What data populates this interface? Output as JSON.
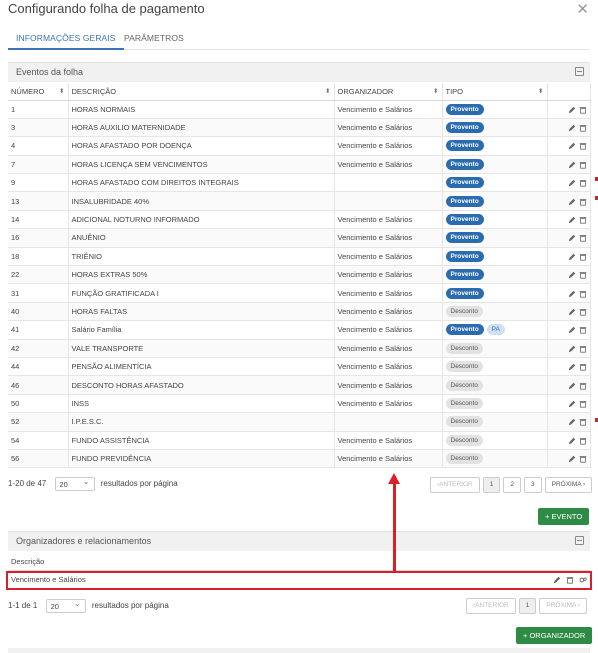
{
  "dialog": {
    "title": "Configurando folha de pagamento"
  },
  "tabs": [
    {
      "label": "INFORMAÇÕES GERAIS",
      "active": true
    },
    {
      "label": "PARÂMETROS",
      "active": false
    }
  ],
  "events_panel": {
    "title": "Eventos da folha",
    "columns": [
      "NÚMERO",
      "DESCRIÇÃO",
      "ORGANIZADOR",
      "TIPO"
    ],
    "rows": [
      {
        "num": "1",
        "desc": "HORAS NORMAIS",
        "org": "Vencimento e Salários",
        "tipo": "Provento"
      },
      {
        "num": "3",
        "desc": "HORAS AUXILIO MATERNIDADE",
        "org": "Vencimento e Salários",
        "tipo": "Provento"
      },
      {
        "num": "4",
        "desc": "HORAS AFASTADO POR DOENÇA",
        "org": "Vencimento e Salários",
        "tipo": "Provento"
      },
      {
        "num": "7",
        "desc": "HORAS LICENÇA SEM VENCIMENTOS",
        "org": "Vencimento e Salários",
        "tipo": "Provento"
      },
      {
        "num": "9",
        "desc": "HORAS AFASTADO COM DIREITOS INTEGRAIS",
        "org": "",
        "tipo": "Provento"
      },
      {
        "num": "13",
        "desc": "INSALUBRIDADE 40%",
        "org": "",
        "tipo": "Provento"
      },
      {
        "num": "14",
        "desc": "ADICIONAL NOTURNO INFORMADO",
        "org": "Vencimento e Salários",
        "tipo": "Provento"
      },
      {
        "num": "16",
        "desc": "ANUÊNIO",
        "org": "Vencimento e Salários",
        "tipo": "Provento"
      },
      {
        "num": "18",
        "desc": "TRIÊNIO",
        "org": "Vencimento e Salários",
        "tipo": "Provento"
      },
      {
        "num": "22",
        "desc": "HORAS EXTRAS 50%",
        "org": "Vencimento e Salários",
        "tipo": "Provento"
      },
      {
        "num": "31",
        "desc": "FUNÇÃO GRATIFICADA I",
        "org": "Vencimento e Salários",
        "tipo": "Provento"
      },
      {
        "num": "40",
        "desc": "HORAS FALTAS",
        "org": "Vencimento e Salários",
        "tipo": "Desconto"
      },
      {
        "num": "41",
        "desc": "Salário Família",
        "org": "Vencimento e Salários",
        "tipo": "Provento",
        "extra": "PA"
      },
      {
        "num": "42",
        "desc": "VALE TRANSPORTE",
        "org": "Vencimento e Salários",
        "tipo": "Desconto"
      },
      {
        "num": "44",
        "desc": "PENSÃO ALIMENTÍCIA",
        "org": "Vencimento e Salários",
        "tipo": "Desconto"
      },
      {
        "num": "46",
        "desc": "DESCONTO HORAS AFASTADO",
        "org": "Vencimento e Salários",
        "tipo": "Desconto"
      },
      {
        "num": "50",
        "desc": "INSS",
        "org": "Vencimento e Salários",
        "tipo": "Desconto"
      },
      {
        "num": "52",
        "desc": "I.P.E.S.C.",
        "org": "",
        "tipo": "Desconto"
      },
      {
        "num": "54",
        "desc": "FUNDO ASSISTÊNCIA",
        "org": "Vencimento e Salários",
        "tipo": "Desconto"
      },
      {
        "num": "56",
        "desc": "FUNDO PREVIDÊNCIA",
        "org": "Vencimento e Salários",
        "tipo": "Desconto"
      }
    ],
    "pager": {
      "range": "1-20 de 47",
      "per_page": "20",
      "per_page_label": "resultados por página",
      "prev": "‹ANTERIOR",
      "pages": [
        "1",
        "2",
        "3"
      ],
      "next": "PRÓXIMA ›"
    },
    "add_button": "+ EVENTO"
  },
  "org_panel": {
    "title": "Organizadores e relacionamentos",
    "column": "Descrição",
    "rows": [
      {
        "desc": "Vencimento e Salários"
      }
    ],
    "pager": {
      "range": "1-1 de 1",
      "per_page": "20",
      "per_page_label": "resultados por página",
      "prev": "‹ANTERIOR",
      "pages": [
        "1"
      ],
      "next": "PRÓXIMA ›"
    },
    "add_button": "+ ORGANIZADOR"
  },
  "colors": {
    "accent": "#3b73b9",
    "provento": "#2b6cb0",
    "green": "#2e8b46",
    "annotation": "#d9202a"
  },
  "icons": [
    "close-icon",
    "collapse-icon",
    "sort-icon",
    "pencil-icon",
    "trash-icon",
    "link-gear-icon"
  ]
}
